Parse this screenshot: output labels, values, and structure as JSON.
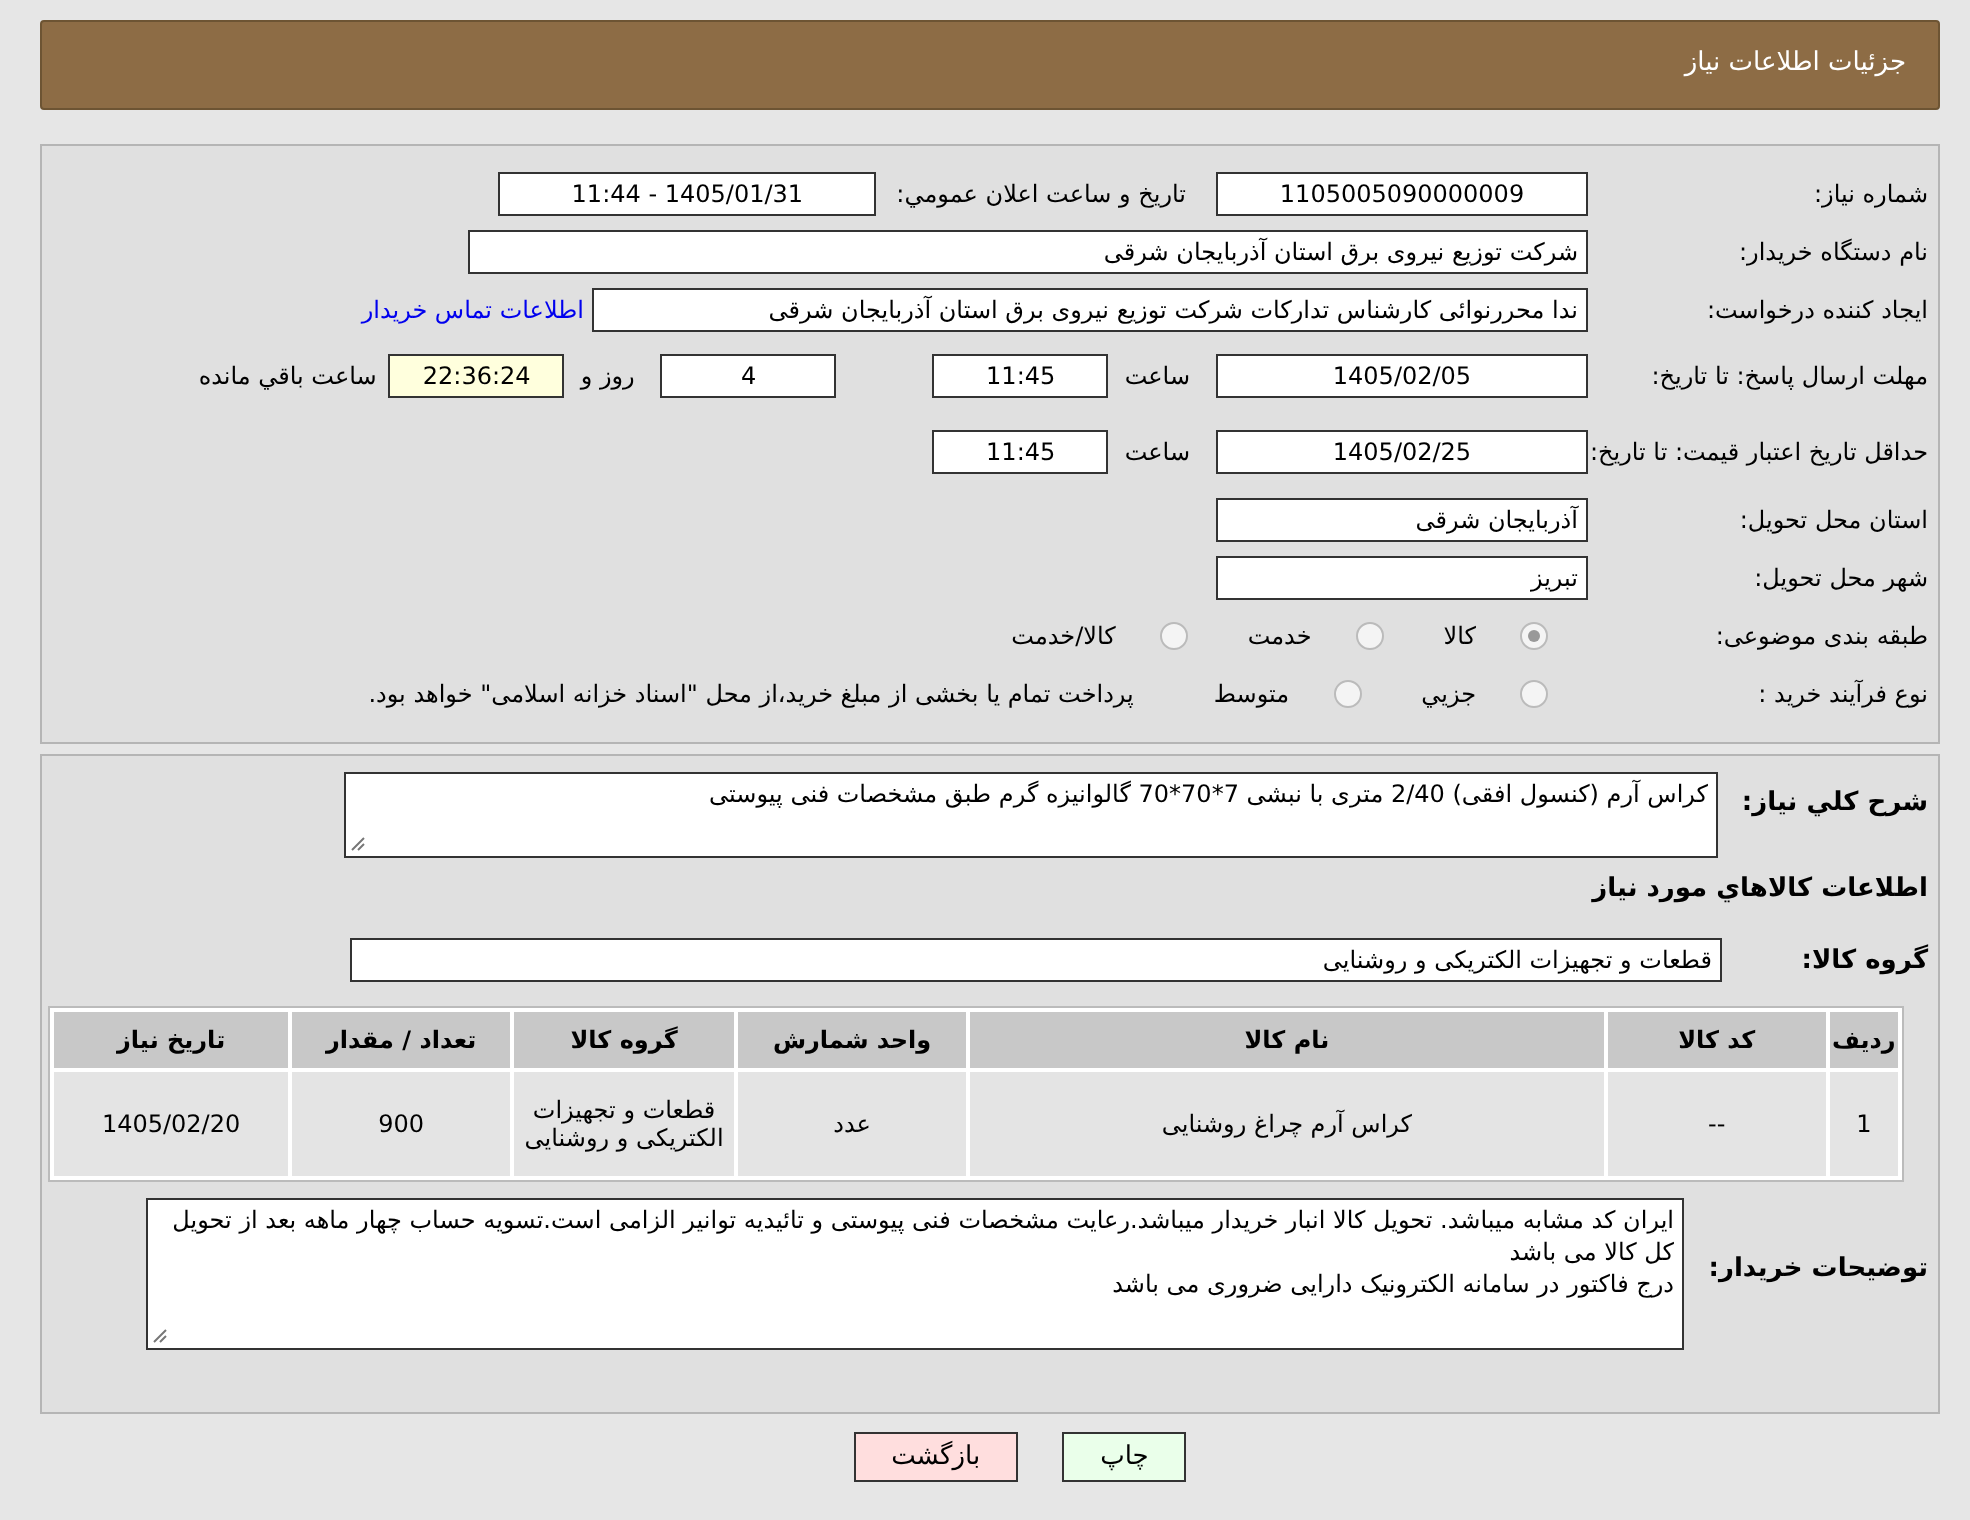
{
  "header": {
    "title": "جزئیات اطلاعات نیاز"
  },
  "form": {
    "need_number": {
      "label": "شماره نیاز:",
      "value": "1105005090000009"
    },
    "announce": {
      "label": "تاریخ و ساعت اعلان عمومي:",
      "value": "1405/01/31 - 11:44"
    },
    "buyer": {
      "label": "نام دستگاه خریدار:",
      "value": "شرکت توزیع نیروی برق استان آذربایجان شرقی"
    },
    "requester": {
      "label": "ایجاد کننده درخواست:",
      "value": "ندا محررنوائی کارشناس تدارکات شرکت توزیع نیروی برق استان آذربایجان شرقی",
      "link": "اطلاعات تماس خریدار"
    },
    "reply_deadline": {
      "label": "مهلت ارسال پاسخ: تا تاریخ:",
      "date": "1405/02/05",
      "time_label": "ساعت",
      "time": "11:45",
      "days": "4",
      "days_label": "روز و",
      "remaining": "22:36:24",
      "remaining_label": "ساعت باقي مانده"
    },
    "price_validity": {
      "label": "حداقل تاریخ اعتبار قیمت: تا تاریخ:",
      "date": "1405/02/25",
      "time_label": "ساعت",
      "time": "11:45"
    },
    "province": {
      "label": "استان محل تحویل:",
      "value": "آذربایجان شرقی"
    },
    "city": {
      "label": "شهر محل تحویل:",
      "value": "تبریز"
    },
    "category": {
      "label": "طبقه بندی موضوعی:",
      "options": [
        {
          "label": "کالا",
          "selected": true
        },
        {
          "label": "خدمت",
          "selected": false
        },
        {
          "label": "کالا/خدمت",
          "selected": false
        }
      ]
    },
    "purchase_type": {
      "label": "نوع فرآیند خرید :",
      "options": [
        {
          "label": "جزيي",
          "selected": false
        },
        {
          "label": "متوسط",
          "selected": false
        }
      ],
      "note": "پرداخت تمام یا بخشی از مبلغ خرید،از محل \"اسناد خزانه اسلامی\" خواهد بود."
    }
  },
  "needs": {
    "description": {
      "label": "شرح کلي نیاز:",
      "value": "کراس آرم (کنسول افقی) 2/40 متری با نبشی 7*70*70 گالوانیزه گرم طبق مشخصات فنی پیوستی"
    },
    "heading": "اطلاعات کالاهاي مورد نیاز",
    "group": {
      "label": "گروه کالا:",
      "value": "قطعات و تجهیزات الکتریکی و روشنایی"
    },
    "table": {
      "columns": [
        "ردیف",
        "کد کالا",
        "نام کالا",
        "واحد شمارش",
        "گروه کالا",
        "تعداد / مقدار",
        "تاریخ نیاز"
      ],
      "rows": [
        [
          "1",
          "--",
          "کراس آرم چراغ روشنایی",
          "عدد",
          "قطعات و تجهیزات الکتریکی و روشنایی",
          "900",
          "1405/02/20"
        ]
      ]
    },
    "notes": {
      "label": "توضیحات خریدار:",
      "value": "ایران کد مشابه میباشد. تحویل کالا انبار خریدار میباشد.رعایت مشخصات فنی پیوستی و تائیدیه توانیر الزامی است.تسویه حساب چهار ماهه بعد از تحویل کل کالا می باشد\nدرج فاکتور در سامانه الکترونیک دارایی ضروری می باشد"
    }
  },
  "buttons": [
    {
      "label": "چاپ",
      "kind": "print"
    },
    {
      "label": "بازگشت",
      "kind": "back"
    }
  ]
}
